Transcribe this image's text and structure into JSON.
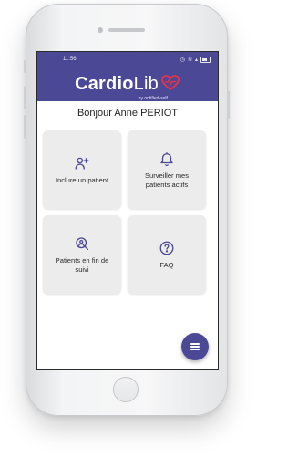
{
  "status_bar": {
    "time": "11:56",
    "icons": [
      "wifi-icon",
      "signal-icon",
      "battery-icon"
    ]
  },
  "app": {
    "brand_bold": "Cardio",
    "brand_light": "Lib",
    "brand_sub": "by ontified-self",
    "accent_color": "#4b4896"
  },
  "greeting": "Bonjour Anne PERIOT",
  "tiles": [
    {
      "label": "Inclure un patient",
      "icon": "add-user-icon"
    },
    {
      "label": "Surveiller mes patients actifs",
      "icon": "bell-icon"
    },
    {
      "label": "Patients en fin de suivi",
      "icon": "search-user-icon"
    },
    {
      "label": "FAQ",
      "icon": "question-icon"
    }
  ],
  "fab": {
    "icon": "menu-icon"
  }
}
